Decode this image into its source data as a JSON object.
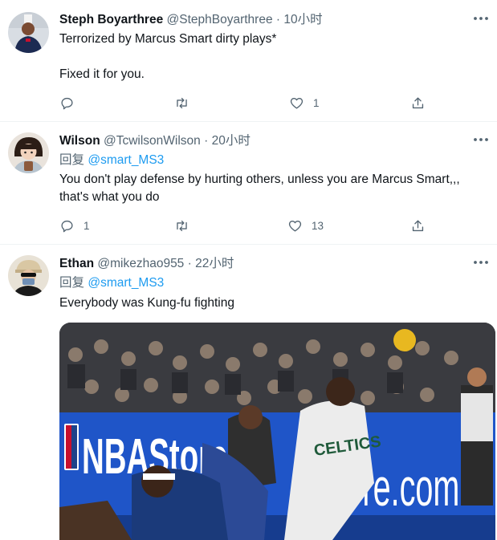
{
  "tweets": [
    {
      "name": "Steph Boyarthree",
      "handle": "@StephBoyarthree",
      "separator": "·",
      "time": "10小时",
      "text_lines": [
        "Terrorized by Marcus Smart dirty plays*",
        "Fixed it for you."
      ],
      "reply_count": "",
      "retweet_count": "",
      "like_count": "1",
      "icons": [
        "reply-icon",
        "retweet-icon",
        "heart-icon",
        "share-icon",
        "more-icon"
      ]
    },
    {
      "name": "Wilson",
      "handle": "@TcwilsonWilson",
      "separator": "·",
      "time": "20小时",
      "reply_prefix": "回复",
      "reply_to": "@smart_MS3",
      "text": "You don't play defense by hurting others, unless you are Marcus Smart,,, that's what you do",
      "reply_count": "1",
      "retweet_count": "",
      "like_count": "13",
      "icons": [
        "reply-icon",
        "retweet-icon",
        "heart-icon",
        "share-icon",
        "more-icon"
      ]
    },
    {
      "name": "Ethan",
      "handle": "@mikezhao955",
      "separator": "·",
      "time": "22小时",
      "reply_prefix": "回复",
      "reply_to": "@smart_MS3",
      "text": "Everybody was Kung-fu fighting",
      "media": {
        "type": "photo",
        "board_text_left": "NBAStore.co",
        "board_text_right": "Store.com",
        "jersey_text": "CELTICS"
      }
    }
  ],
  "colors": {
    "text": "#0f1419",
    "secondary": "#536471",
    "link": "#1d9bf0",
    "divider": "#eff3f4",
    "board_blue": "#1f55c8"
  }
}
